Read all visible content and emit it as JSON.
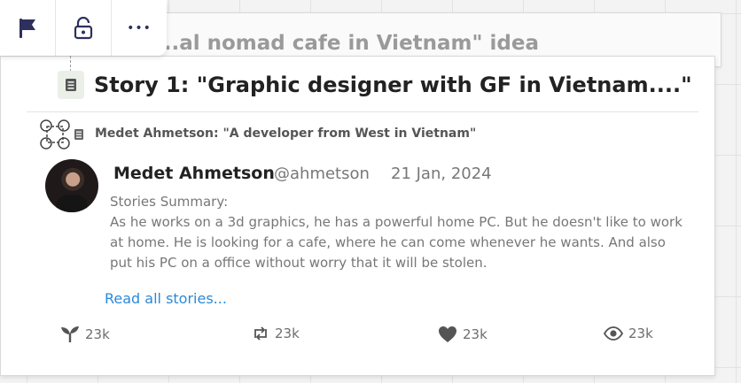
{
  "background_card": {
    "title": "...al nomad cafe in Vietnam\" idea"
  },
  "toolbar": {
    "items": [
      {
        "icon": "flag-icon"
      },
      {
        "icon": "unlock-icon"
      },
      {
        "icon": "more-icon",
        "label": "•••"
      }
    ]
  },
  "story": {
    "title": "Story 1: \"Graphic designer with GF in Vietnam....\"",
    "subtitle": "Medet Ahmetson: \"A developer from West in Vietnam\""
  },
  "post": {
    "author": "Medet Ahmetson",
    "handle": "@ahmetson",
    "date": "21 Jan, 2024",
    "summary_label": "Stories Summary:",
    "summary_text": "As he works on a 3d graphics, he has a powerful home PC. But he doesn't like to work at home. He is looking for a cafe, where he can come whenever he wants. And also put his PC on a office without worry that it will be stolen.",
    "read_more": "Read all stories..."
  },
  "stats": {
    "sprouts": "23k",
    "reposts": "23k",
    "likes": "23k",
    "views": "23k"
  },
  "colors": {
    "link": "#2b8ad8",
    "toolbar_icon": "#2d2f5e"
  }
}
